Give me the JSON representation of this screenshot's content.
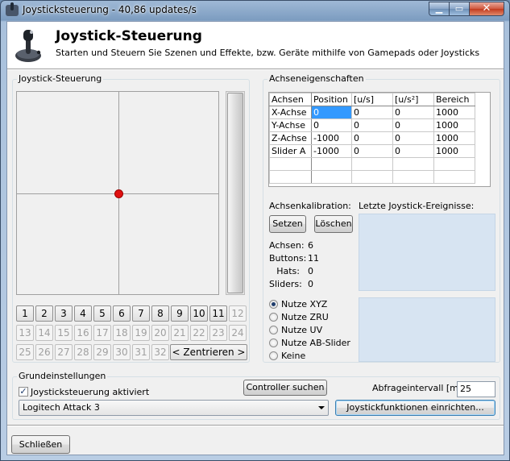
{
  "window": {
    "title": "Joysticksteuerung - 40,86 updates/s",
    "min_glyph": "▁",
    "max_glyph": "▭",
    "close_glyph": "✕"
  },
  "header": {
    "title": "Joystick-Steuerung",
    "subtitle": "Starten und Steuern Sie Szenen und Effekte, bzw. Geräte mithilfe von Gamepads oder Joysticks",
    "icon": "joystick-icon"
  },
  "joystick_group": {
    "label": "Joystick-Steuerung",
    "buttons": [
      {
        "label": "1",
        "enabled": true
      },
      {
        "label": "2",
        "enabled": true
      },
      {
        "label": "3",
        "enabled": true
      },
      {
        "label": "4",
        "enabled": true
      },
      {
        "label": "5",
        "enabled": true
      },
      {
        "label": "6",
        "enabled": true
      },
      {
        "label": "7",
        "enabled": true
      },
      {
        "label": "8",
        "enabled": true
      },
      {
        "label": "9",
        "enabled": true
      },
      {
        "label": "10",
        "enabled": true
      },
      {
        "label": "11",
        "enabled": true
      },
      {
        "label": "12",
        "enabled": false
      },
      {
        "label": "13",
        "enabled": false
      },
      {
        "label": "14",
        "enabled": false
      },
      {
        "label": "15",
        "enabled": false
      },
      {
        "label": "16",
        "enabled": false
      },
      {
        "label": "17",
        "enabled": false
      },
      {
        "label": "18",
        "enabled": false
      },
      {
        "label": "19",
        "enabled": false
      },
      {
        "label": "20",
        "enabled": false
      },
      {
        "label": "21",
        "enabled": false
      },
      {
        "label": "22",
        "enabled": false
      },
      {
        "label": "23",
        "enabled": false
      },
      {
        "label": "24",
        "enabled": false
      },
      {
        "label": "25",
        "enabled": false
      },
      {
        "label": "26",
        "enabled": false
      },
      {
        "label": "27",
        "enabled": false
      },
      {
        "label": "28",
        "enabled": false
      },
      {
        "label": "29",
        "enabled": false
      },
      {
        "label": "30",
        "enabled": false
      },
      {
        "label": "31",
        "enabled": false
      },
      {
        "label": "32",
        "enabled": false
      }
    ],
    "center_button": "< Zentrieren >",
    "dot_color": "#e01010"
  },
  "axis_group": {
    "label": "Achseneigenschaften",
    "columns": [
      "Achsen",
      "Position",
      "[u/s]",
      "[u/s²]",
      "Bereich"
    ],
    "rows": [
      [
        "X-Achse",
        "0",
        "0",
        "0",
        "1000"
      ],
      [
        "Y-Achse",
        "0",
        "0",
        "0",
        "1000"
      ],
      [
        "Z-Achse",
        "-1000",
        "0",
        "0",
        "1000"
      ],
      [
        "Slider A",
        "-1000",
        "0",
        "0",
        "1000"
      ]
    ],
    "calibration_label": "Achsenkalibration:",
    "set_button": "Setzen",
    "delete_button": "Löschen",
    "events_label": "Letzte Joystick-Ereignisse:",
    "stats": [
      {
        "label": "Achsen:",
        "value": "6"
      },
      {
        "label": "Buttons:",
        "value": "11"
      },
      {
        "label": "Hats:",
        "value": "0"
      },
      {
        "label": "Sliders:",
        "value": "0"
      }
    ],
    "radio_options": [
      {
        "label": "Nutze XYZ",
        "selected": true
      },
      {
        "label": "Nutze ZRU",
        "selected": false
      },
      {
        "label": "Nutze UV",
        "selected": false
      },
      {
        "label": "Nutze AB-Slider",
        "selected": false
      },
      {
        "label": "Keine",
        "selected": false
      }
    ]
  },
  "basic_group": {
    "label": "Grundeinstellungen",
    "enabled_checkbox": "Joysticksteuerung aktiviert",
    "search_button": "Controller suchen",
    "interval_label": "Abfrageintervall [ms]:",
    "interval_value": "25",
    "device_selected": "Logitech Attack 3",
    "setup_button": "Joystickfunktionen einrichten..."
  },
  "footer": {
    "close_button": "Schließen"
  }
}
